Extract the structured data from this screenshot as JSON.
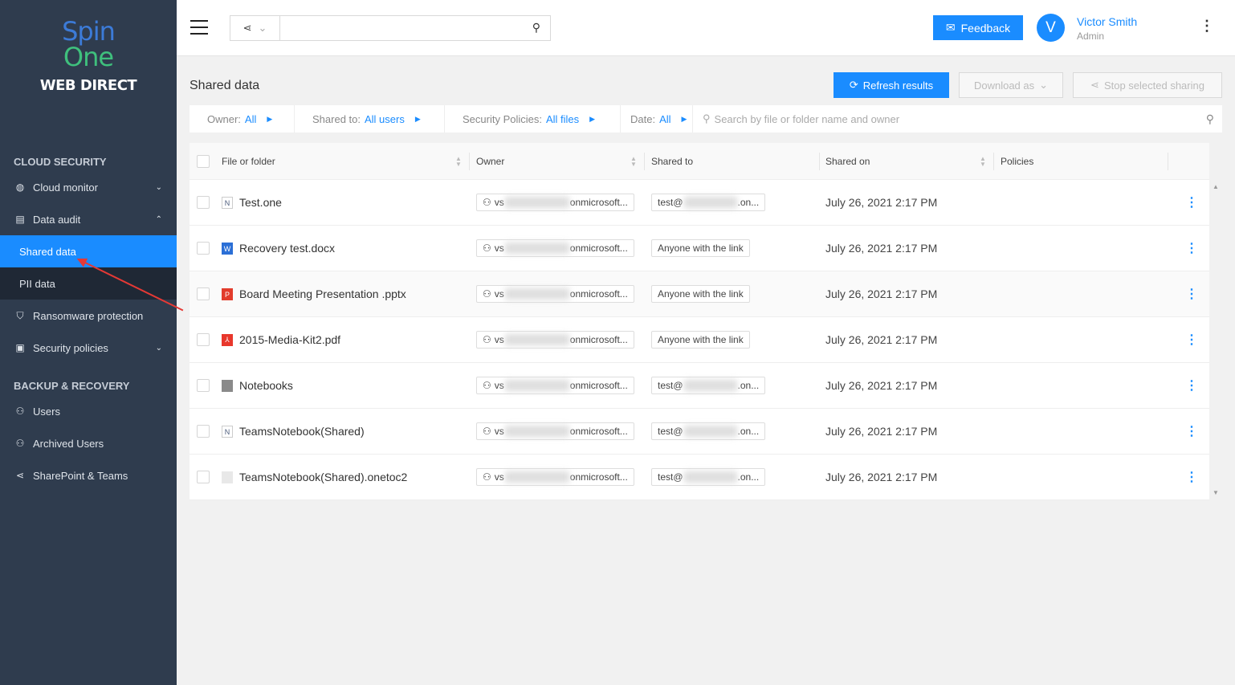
{
  "brand": {
    "line1": "Spin",
    "line2": "One",
    "line3": "WEB DIRECT"
  },
  "sidebar": {
    "section_cloud": "CLOUD SECURITY",
    "section_backup": "BACKUP & RECOVERY",
    "items": [
      {
        "label": "Cloud monitor",
        "icon": "globe-icon"
      },
      {
        "label": "Data audit",
        "icon": "list-icon"
      },
      {
        "label": "Shared data"
      },
      {
        "label": "PII data"
      },
      {
        "label": "Ransomware protection",
        "icon": "shield-icon"
      },
      {
        "label": "Security policies",
        "icon": "policy-icon"
      },
      {
        "label": "Users",
        "icon": "users-icon"
      },
      {
        "label": "Archived Users",
        "icon": "users-icon"
      },
      {
        "label": "SharePoint & Teams",
        "icon": "share-icon"
      }
    ]
  },
  "header": {
    "search_placeholder": "",
    "feedback": "Feedback",
    "user_initial": "V",
    "user_name": "Victor Smith",
    "user_role": "Admin"
  },
  "page": {
    "title": "Shared data",
    "refresh": "Refresh results",
    "download": "Download as",
    "stop": "Stop selected sharing"
  },
  "filters": {
    "owner_label": "Owner:",
    "owner_value": "All",
    "shared_label": "Shared to:",
    "shared_value": "All users",
    "policies_label": "Security Policies:",
    "policies_value": "All files",
    "date_label": "Date:",
    "date_value": "All",
    "search_placeholder": "Search by file or folder name and owner"
  },
  "table": {
    "columns": [
      "File or folder",
      "Owner",
      "Shared to",
      "Shared on",
      "Policies"
    ],
    "rows": [
      {
        "name": "Test.one",
        "type": "onenote",
        "owner_prefix": "vs",
        "owner_suffix": "onmicrosoft...",
        "shared_prefix": "test@",
        "shared_suffix": ".on...",
        "shared_on": "July 26, 2021 2:17 PM"
      },
      {
        "name": "Recovery test.docx",
        "type": "word",
        "owner_prefix": "vs",
        "owner_suffix": "onmicrosoft...",
        "shared_prefix": "Anyone with the link",
        "shared_suffix": "",
        "shared_on": "July 26, 2021 2:17 PM"
      },
      {
        "name": "Board Meeting Presentation .pptx",
        "type": "powerpoint",
        "owner_prefix": "vs",
        "owner_suffix": "onmicrosoft...",
        "shared_prefix": "Anyone with the link",
        "shared_suffix": "",
        "shared_on": "July 26, 2021 2:17 PM"
      },
      {
        "name": "2015-Media-Kit2.pdf",
        "type": "pdf",
        "owner_prefix": "vs",
        "owner_suffix": "onmicrosoft...",
        "shared_prefix": "Anyone with the link",
        "shared_suffix": "",
        "shared_on": "July 26, 2021 2:17 PM"
      },
      {
        "name": "Notebooks",
        "type": "folder",
        "owner_prefix": "vs",
        "owner_suffix": "onmicrosoft...",
        "shared_prefix": "test@",
        "shared_suffix": ".on...",
        "shared_on": "July 26, 2021 2:17 PM"
      },
      {
        "name": "TeamsNotebook(Shared)",
        "type": "onenote",
        "owner_prefix": "vs",
        "owner_suffix": "onmicrosoft...",
        "shared_prefix": "test@",
        "shared_suffix": ".on...",
        "shared_on": "July 26, 2021 2:17 PM"
      },
      {
        "name": "TeamsNotebook(Shared).onetoc2",
        "type": "file",
        "owner_prefix": "vs",
        "owner_suffix": "onmicrosoft...",
        "shared_prefix": "test@",
        "shared_suffix": ".on...",
        "shared_on": "July 26, 2021 2:17 PM"
      }
    ]
  },
  "colors": {
    "accent": "#1a8cff",
    "sidebar": "#2f3c4e"
  }
}
